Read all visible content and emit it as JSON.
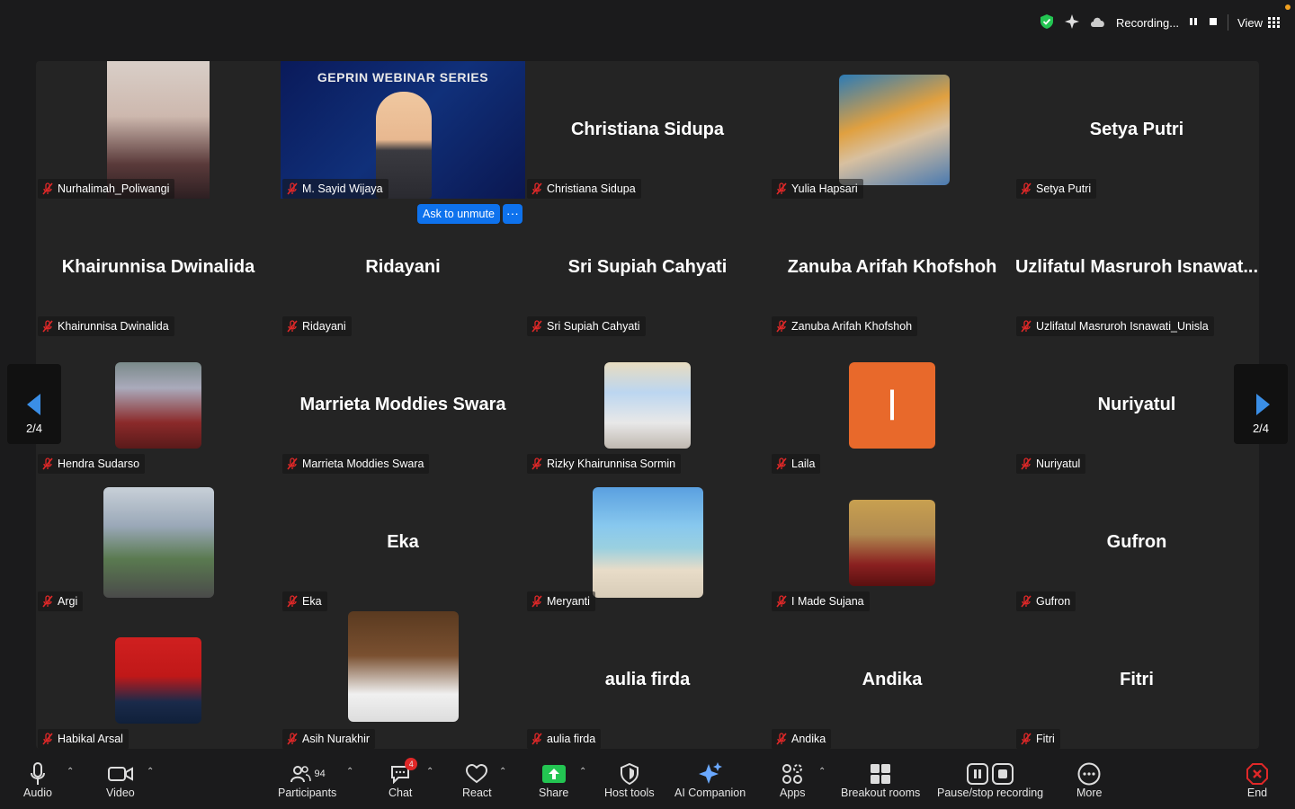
{
  "topbar": {
    "recording_label": "Recording...",
    "view_label": "View"
  },
  "unmute": {
    "ask_label": "Ask to unmute",
    "more_label": "···"
  },
  "nav": {
    "page_label_left": "2/4",
    "page_label_right": "2/4"
  },
  "tiles": [
    {
      "name": "Nurhalimah_Poliwangi",
      "big": "",
      "img": "nurhalimah"
    },
    {
      "name": "M. Sayid Wijaya",
      "big": "",
      "img": "sayid",
      "overlay_title": "GEPRIN WEBINAR SERIES"
    },
    {
      "name": "Christiana Sidupa",
      "big": "Christiana Sidupa",
      "img": ""
    },
    {
      "name": "Yulia Hapsari",
      "big": "",
      "img": "yulia"
    },
    {
      "name": "Setya Putri",
      "big": "Setya Putri",
      "img": ""
    },
    {
      "name": "Khairunnisa Dwinalida",
      "big": "Khairunnisa Dwinalida",
      "img": ""
    },
    {
      "name": "Ridayani",
      "big": "Ridayani",
      "img": ""
    },
    {
      "name": "Sri Supiah Cahyati",
      "big": "Sri Supiah Cahyati",
      "img": ""
    },
    {
      "name": "Zanuba Arifah Khofshoh",
      "big": "Zanuba Arifah Khofshoh",
      "img": ""
    },
    {
      "name": "Uzlifatul Masruroh Isnawati_Unisla",
      "big": "Uzlifatul Masruroh Isnawat...",
      "img": ""
    },
    {
      "name": "Hendra Sudarso",
      "big": "",
      "img": "hendra"
    },
    {
      "name": "Marrieta Moddies Swara",
      "big": "Marrieta Moddies Swara",
      "img": ""
    },
    {
      "name": "Rizky Khairunnisa Sormin",
      "big": "",
      "img": "rizky"
    },
    {
      "name": "Laila",
      "big": "",
      "img": "laila",
      "initial": "l"
    },
    {
      "name": "Nuriyatul",
      "big": "Nuriyatul",
      "img": ""
    },
    {
      "name": "Argi",
      "big": "",
      "img": "argi"
    },
    {
      "name": "Eka",
      "big": "Eka",
      "img": ""
    },
    {
      "name": "Meryanti",
      "big": "",
      "img": "meryanti"
    },
    {
      "name": "I Made Sujana",
      "big": "",
      "img": "imade"
    },
    {
      "name": "Gufron",
      "big": "Gufron",
      "img": ""
    },
    {
      "name": "Habikal Arsal",
      "big": "",
      "img": "habikal"
    },
    {
      "name": "Asih Nurakhir",
      "big": "",
      "img": "asih"
    },
    {
      "name": "aulia firda",
      "big": "aulia firda",
      "img": ""
    },
    {
      "name": "Andika",
      "big": "Andika",
      "img": ""
    },
    {
      "name": "Fitri",
      "big": "Fitri",
      "img": ""
    }
  ],
  "toolbar": {
    "audio": "Audio",
    "video": "Video",
    "participants": "Participants",
    "participants_count": "94",
    "chat": "Chat",
    "chat_badge": "4",
    "react": "React",
    "share": "Share",
    "host_tools": "Host tools",
    "ai_companion": "AI Companion",
    "apps": "Apps",
    "breakout": "Breakout rooms",
    "pause_record": "Pause/stop recording",
    "more": "More",
    "end": "End"
  },
  "colors": {
    "accent": "#0e72ed",
    "laila_avatar": "#e8692b",
    "share_green": "#23c552",
    "end_red": "#e02828"
  }
}
